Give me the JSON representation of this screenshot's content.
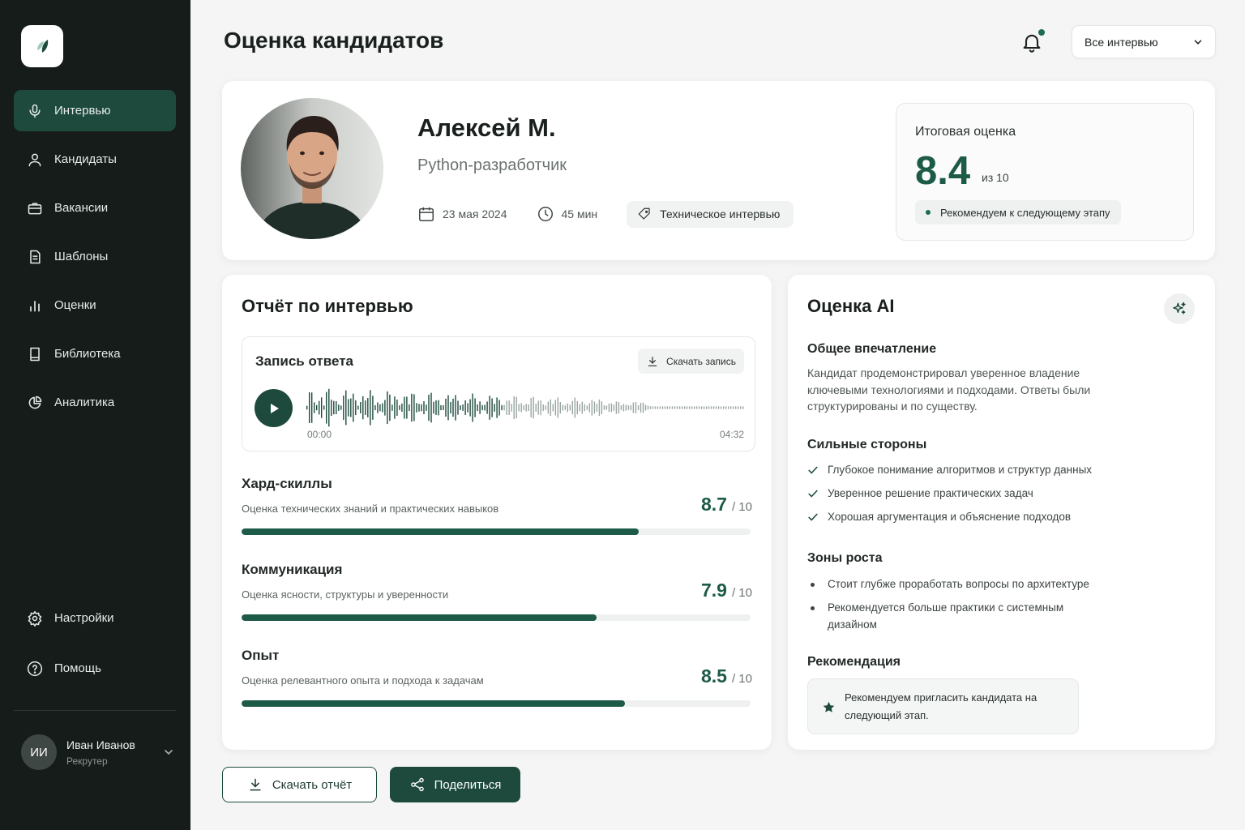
{
  "sidebar": {
    "nav": [
      {
        "label": "Интервью",
        "icon": "microphone-icon",
        "active": true
      },
      {
        "label": "Кандидаты",
        "icon": "user-icon"
      },
      {
        "label": "Вакансии",
        "icon": "briefcase-icon"
      },
      {
        "label": "Шаблоны",
        "icon": "document-icon"
      },
      {
        "label": "Оценки",
        "icon": "bar-chart-icon"
      },
      {
        "label": "Библиотека",
        "icon": "book-icon"
      },
      {
        "label": "Аналитика",
        "icon": "pie-chart-icon"
      }
    ],
    "bottom": [
      {
        "label": "Настройки",
        "icon": "gear-icon"
      },
      {
        "label": "Помощь",
        "icon": "help-icon"
      }
    ],
    "user": {
      "initials": "ИИ",
      "name": "Иван Иванов",
      "role": "Рекрутер"
    }
  },
  "header": {
    "title": "Оценка кандидатов",
    "filter": "Все интервью"
  },
  "candidate": {
    "name": "Алексей М.",
    "role": "Python-разработчик",
    "date": "23 мая 2024",
    "duration": "45 мин",
    "type": "Техническое интервью",
    "score_label": "Итоговая оценка",
    "score": "8.4",
    "score_of": "из 10",
    "recommendation": "Рекомендуем к следующему этапу"
  },
  "report": {
    "title": "Отчёт по интервью",
    "recording": {
      "title": "Запись ответа",
      "download": "Скачать запись",
      "time_start": "00:00",
      "time_end": "04:32"
    },
    "metrics": [
      {
        "title": "Хард-скиллы",
        "desc": "Оценка технических знаний и практических навыков",
        "score": "8.7",
        "max": "/ 10",
        "value": 0.78
      },
      {
        "title": "Коммуникация",
        "desc": "Оценка ясности, структуры и уверенности",
        "score": "7.9",
        "max": "/ 10",
        "value": 0.697
      },
      {
        "title": "Опыт",
        "desc": "Оценка релевантного опыта и подхода к задачам",
        "score": "8.5",
        "max": "/ 10",
        "value": 0.753
      }
    ]
  },
  "ai": {
    "title": "Оценка AI",
    "impression_title": "Общее впечатление",
    "impression": "Кандидат продемонстрировал уверенное владение ключевыми технологиями и подходами. Ответы были структурированы и по существу.",
    "strengths_title": "Сильные стороны",
    "strengths": [
      "Глубокое понимание алгоритмов и структур данных",
      "Уверенное решение практических задач",
      "Хорошая аргументация и объяснение подходов"
    ],
    "growth_title": "Зоны роста",
    "growth": [
      "Стоит глубже проработать вопросы по архитектуре",
      "Рекомендуется больше практики с системным дизайном"
    ],
    "recommendation_title": "Рекомендация",
    "recommendation": "Рекомендуем пригласить кандидата на следующий этап."
  },
  "actions": {
    "download_report": "Скачать отчёт",
    "share": "Поделиться"
  },
  "colors": {
    "sidebar_bg": "#151c1a",
    "accent": "#1d4a3d",
    "accent_text": "#1d5a48"
  }
}
